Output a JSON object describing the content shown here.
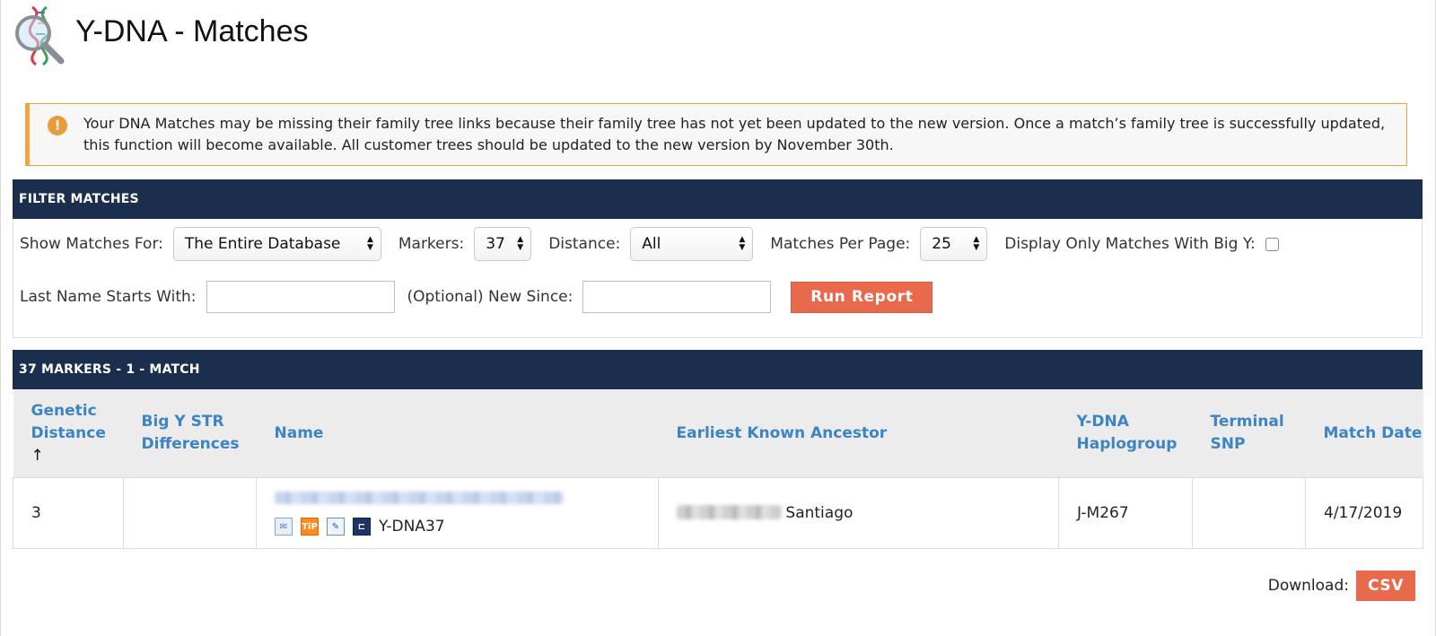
{
  "header": {
    "title": "Y-DNA - Matches"
  },
  "notice": {
    "text": "Your DNA Matches may be missing their family tree links because their family tree has not yet been updated to the new version. Once a match’s family tree is successfully updated, this function will become available. All customer trees should be updated to the new version by November 30th."
  },
  "filter": {
    "section_title": "FILTER MATCHES",
    "show_matches_label": "Show Matches For:",
    "show_matches_value": "The Entire Database",
    "markers_label": "Markers:",
    "markers_value": "37",
    "distance_label": "Distance:",
    "distance_value": "All",
    "per_page_label": "Matches Per Page:",
    "per_page_value": "25",
    "bigy_label": "Display Only Matches With Big Y:",
    "last_name_label": "Last Name Starts With:",
    "last_name_value": "",
    "new_since_label": "(Optional) New Since:",
    "new_since_value": "",
    "run_button": "Run Report"
  },
  "results": {
    "section_title": "37 MARKERS - 1 - MATCH",
    "columns": {
      "genetic_distance": "Genetic Distance",
      "big_y": "Big Y STR Differences",
      "name": "Name",
      "ancestor": "Earliest Known Ancestor",
      "haplogroup": "Y-DNA Haplogroup",
      "terminal_snp": "Terminal SNP",
      "match_date": "Match Date"
    },
    "sort_arrow": "↑",
    "rows": [
      {
        "genetic_distance": "3",
        "big_y": "",
        "test_label": "Y-DNA37",
        "ancestor_surname": "Santiago",
        "haplogroup": "J-M267",
        "terminal_snp": "",
        "match_date": "4/17/2019"
      }
    ]
  },
  "download": {
    "label": "Download:",
    "csv_button": "CSV"
  },
  "colors": {
    "navy": "#1b2e4d",
    "accent": "#e86a4c",
    "link": "#3c84c4",
    "notice_border": "#f1a541"
  },
  "icons": [
    "dna-magnifier-logo-icon",
    "info-icon",
    "email-icon",
    "tip-icon",
    "notes-icon",
    "pedigree-tree-icon"
  ]
}
